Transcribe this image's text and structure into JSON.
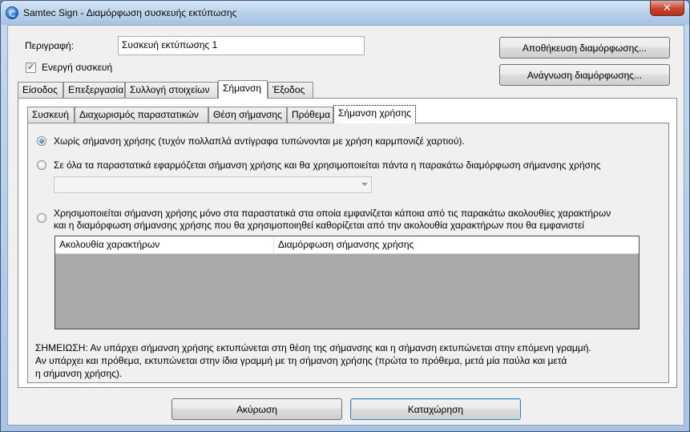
{
  "window": {
    "title": "Samtec Sign - Διαμόρφωση συσκευής εκτύπωσης",
    "close_glyph": "✕"
  },
  "description": {
    "label": "Περιγραφή:",
    "value": "Συσκευή εκτύπωσης 1"
  },
  "active_device": {
    "label": "Ενεργή συσκευή",
    "checked": true,
    "check_glyph": "✓"
  },
  "buttons": {
    "save_config": "Αποθήκευση διαμόρφωσης...",
    "load_config": "Ανάγνωση διαμόρφωσης...",
    "cancel": "Ακύρωση",
    "submit": "Καταχώρηση"
  },
  "main_tabs": [
    {
      "label": "Είσοδος"
    },
    {
      "label": "Επεξεργασία"
    },
    {
      "label": "Συλλογή στοιχείων"
    },
    {
      "label": "Σήμανση",
      "active": true
    },
    {
      "label": "Έξοδος"
    }
  ],
  "sub_tabs": [
    {
      "label": "Συσκευή"
    },
    {
      "label": "Διαχωρισμός παραστατικών"
    },
    {
      "label": "Θέση σήμανσης"
    },
    {
      "label": "Πρόθεμα"
    },
    {
      "label": "Σήμανση χρήσης",
      "active": true
    }
  ],
  "options": {
    "no_usage": "Χωρίς σήμανση χρήσης (τυχόν πολλαπλά αντίγραφα τυπώνονται με χρήση καρμπονιζέ χαρτιού).",
    "all_docs": "Σε όλα τα παραστατικά εφαρμόζεται σήμανση χρήσης και θα χρησιμοποιείται πάντα η παρακάτω διαμόρφωση σήμανσης χρήσης",
    "some_docs_line1": "Χρησιμοποιείται σήμανση χρήσης μόνο στα παραστατικά στα οποία εμφανίζεται κάποια από τις παρακάτω ακολουθίες χαρακτήρων",
    "some_docs_line2": "και η διαμόρφωση σήμανσης χρήσης που θα χρησιμοποιηθεί καθορίζεται από την ακολουθία χαρακτήρων που θα εμφανιστεί",
    "selected": "no_usage"
  },
  "config_combo": {
    "value": ""
  },
  "table": {
    "columns": [
      "Ακολουθία χαρακτήρων",
      "Διαμόρφωση σήμανσης χρήσης"
    ],
    "rows": []
  },
  "note": {
    "line1": "ΣΗΜΕΙΩΣΗ: Αν υπάρχει σήμανση χρήσης εκτυπώνεται στη θέση της σήμανσης και η σήμανση εκτυπώνεται στην επόμενη γραμμή.",
    "line2": "Αν υπάρχει και πρόθεμα, εκτυπώνεται στην ίδια γραμμή με τη σήμανση χρήσης (πρώτα το πρόθεμα, μετά μία παύλα και μετά",
    "line3": "η σήμανση χρήσης)."
  }
}
